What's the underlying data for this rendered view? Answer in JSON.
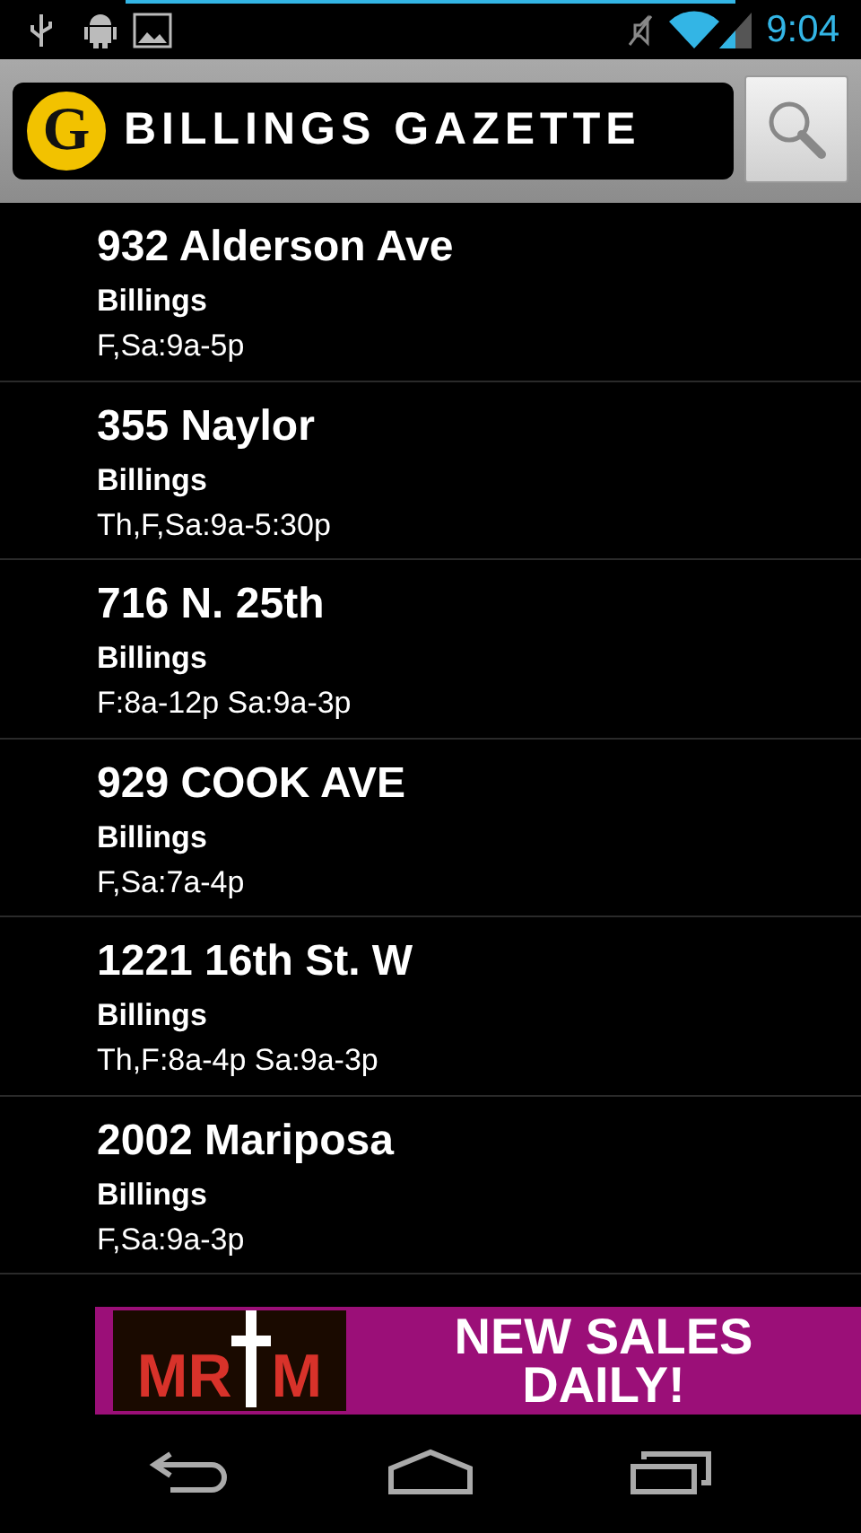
{
  "status_bar": {
    "time": "9:04"
  },
  "header": {
    "logo_initial": "G",
    "title": "BILLINGS GAZETTE"
  },
  "listings": [
    {
      "address": "932 Alderson Ave",
      "city": "Billings",
      "hours": "F,Sa:9a-5p"
    },
    {
      "address": "355 Naylor",
      "city": "Billings",
      "hours": "Th,F,Sa:9a-5:30p"
    },
    {
      "address": "716 N. 25th",
      "city": "Billings",
      "hours": "F:8a-12p Sa:9a-3p"
    },
    {
      "address": "929 COOK AVE",
      "city": "Billings",
      "hours": "F,Sa:7a-4p"
    },
    {
      "address": "1221 16th St. W",
      "city": "Billings",
      "hours": "Th,F:8a-4p Sa:9a-3p"
    },
    {
      "address": "2002 Mariposa",
      "city": "Billings",
      "hours": "F,Sa:9a-3p"
    }
  ],
  "ad": {
    "logo_left": "MR",
    "logo_right": "M",
    "headline_1": "NEW SALES",
    "headline_2": "DAILY!"
  }
}
